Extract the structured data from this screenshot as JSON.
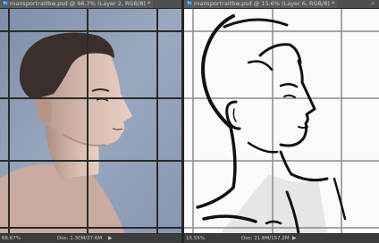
{
  "left_document": {
    "tab_title": "mansportraitbw.psd @ 66.7% (Layer 2, RGB/8) *",
    "zoom": "66.67%",
    "doc_size": "Doc: 1.30M/27.6M"
  },
  "right_document": {
    "tab_title": "mansportraitbw.psd @ 15.6% (Layer 6, RGB/8) *",
    "zoom": "15.55%",
    "doc_size": "Doc: 21.8M/157.2M"
  },
  "icons": {
    "app": "ps-document-icon",
    "close": "close-icon",
    "status_menu": "triangle-right-icon"
  },
  "colors": {
    "photo_background": "#8f9fb8",
    "grid_lines": "#2a2a2a",
    "sketch_ink": "#111111",
    "canvas_white": "#fafafa"
  }
}
